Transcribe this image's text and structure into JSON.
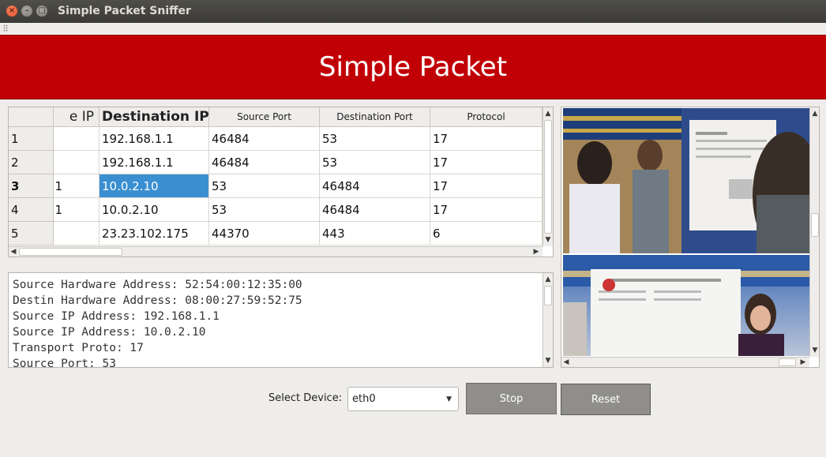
{
  "window": {
    "title": "Simple Packet Sniffer"
  },
  "header": {
    "title": "Simple Packet"
  },
  "table": {
    "columns": [
      "e IP",
      "Destination IP",
      "Source Port",
      "Destination Port",
      "Protocol"
    ],
    "rows": [
      {
        "num": "1",
        "src": "",
        "dst": "192.168.1.1",
        "sport": "46484",
        "dport": "53",
        "proto": "17"
      },
      {
        "num": "2",
        "src": "",
        "dst": "192.168.1.1",
        "sport": "46484",
        "dport": "53",
        "proto": "17"
      },
      {
        "num": "3",
        "src": ".1",
        "dst": "10.0.2.10",
        "sport": "53",
        "dport": "46484",
        "proto": "17"
      },
      {
        "num": "4",
        "src": ".1",
        "dst": "10.0.2.10",
        "sport": "53",
        "dport": "46484",
        "proto": "17"
      },
      {
        "num": "5",
        "src": "",
        "dst": "23.23.102.175",
        "sport": "44370",
        "dport": "443",
        "proto": "6"
      }
    ],
    "selected_row": 3
  },
  "details": {
    "lines": [
      "Source Hardware Address: 52:54:00:12:35:00",
      "Destin Hardware Address: 08:00:27:59:52:75",
      "Source IP Address: 192.168.1.1",
      "Source IP Address: 10.0.2.10",
      "Transport Proto: 17",
      "Source Port: 53"
    ]
  },
  "controls": {
    "device_label": "Select Device:",
    "device_value": "eth0",
    "stop_label": "Stop",
    "reset_label": "Reset"
  },
  "icons": {
    "close": "close-icon",
    "minimize": "minimize-icon",
    "maximize": "maximize-icon",
    "caret": "chevron-down-icon",
    "arrow_up": "arrow-up-icon",
    "arrow_down": "arrow-down-icon",
    "arrow_left": "arrow-left-icon",
    "arrow_right": "arrow-right-icon"
  },
  "colors": {
    "header": "#c10006",
    "selection": "#3a8fd0",
    "button": "#8f8e8b"
  }
}
